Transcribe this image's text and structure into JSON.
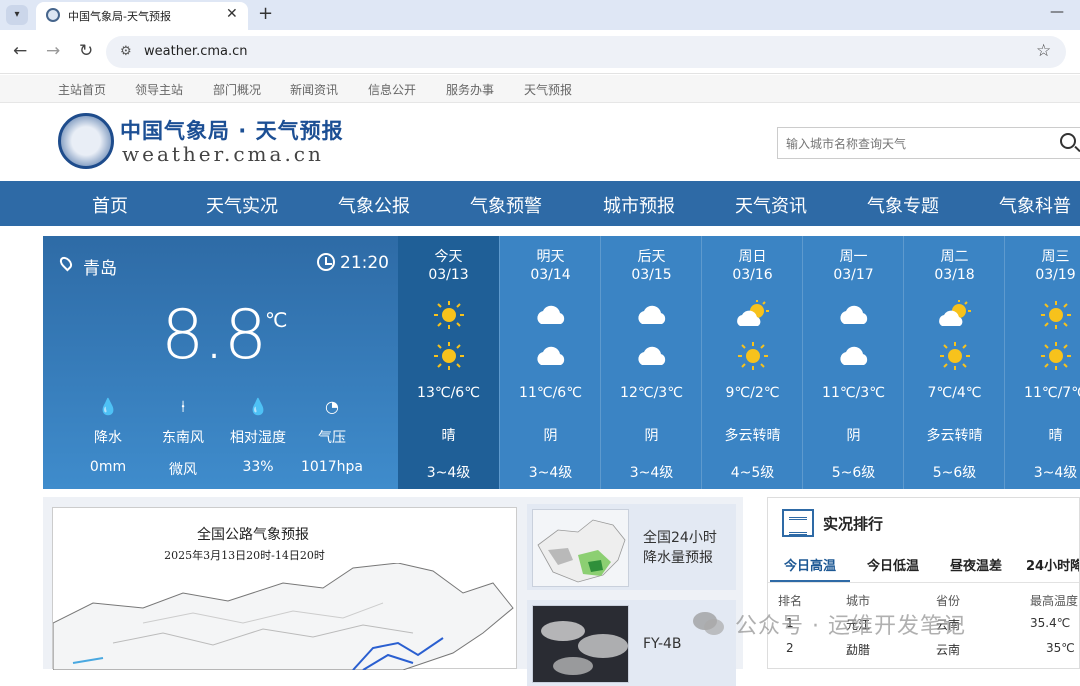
{
  "browser": {
    "tab_title": "中国气象局-天气预报",
    "url": "weather.cma.cn"
  },
  "topnav": [
    "主站首页",
    "领导主站",
    "部门概况",
    "新闻资讯",
    "信息公开",
    "服务办事",
    "天气预报"
  ],
  "logo": {
    "cn": "中国气象局 · 天气预报",
    "en": "weather.cma.cn"
  },
  "search": {
    "placeholder": "输入城市名称查询天气"
  },
  "mainnav": [
    "首页",
    "天气实况",
    "气象公报",
    "气象预警",
    "城市预报",
    "天气资讯",
    "气象专题",
    "气象科普"
  ],
  "current": {
    "city": "青岛",
    "time": "21:20",
    "temperature": "8.8",
    "unit": "℃",
    "metrics": [
      {
        "label": "降水",
        "value": "0mm",
        "icon": "raindrop-icon"
      },
      {
        "label": "东南风",
        "value": "微风",
        "icon": "wind-icon"
      },
      {
        "label": "相对湿度",
        "value": "33%",
        "icon": "humidity-icon"
      },
      {
        "label": "气压",
        "value": "1017hpa",
        "icon": "pressure-icon"
      }
    ]
  },
  "forecast": [
    {
      "day": "今天",
      "date": "03/13",
      "icon_day": "sunny",
      "icon_night": "sunny",
      "range": "13℃/6℃",
      "desc": "晴",
      "wind": "3~4级"
    },
    {
      "day": "明天",
      "date": "03/14",
      "icon_day": "cloudy",
      "icon_night": "cloudy",
      "range": "11℃/6℃",
      "desc": "阴",
      "wind": "3~4级"
    },
    {
      "day": "后天",
      "date": "03/15",
      "icon_day": "cloudy",
      "icon_night": "cloudy",
      "range": "12℃/3℃",
      "desc": "阴",
      "wind": "3~4级"
    },
    {
      "day": "周日",
      "date": "03/16",
      "icon_day": "partly-cloudy",
      "icon_night": "sunny",
      "range": "9℃/2℃",
      "desc": "多云转晴",
      "wind": "4~5级"
    },
    {
      "day": "周一",
      "date": "03/17",
      "icon_day": "cloudy",
      "icon_night": "cloudy",
      "range": "11℃/3℃",
      "desc": "阴",
      "wind": "5~6级"
    },
    {
      "day": "周二",
      "date": "03/18",
      "icon_day": "partly-cloudy",
      "icon_night": "sunny",
      "range": "7℃/4℃",
      "desc": "多云转晴",
      "wind": "5~6级"
    },
    {
      "day": "周三",
      "date": "03/19",
      "icon_day": "sunny",
      "icon_night": "sunny",
      "range": "11℃/7℃",
      "desc": "晴",
      "wind": "3~4级"
    }
  ],
  "map": {
    "title": "全国公路气象预报",
    "subtitle": "2025年3月13日20时-14日20时"
  },
  "thumbs": [
    {
      "label_line1": "全国24小时",
      "label_line2": "降水量预报"
    },
    {
      "label_line1": "FY-4B",
      "label_line2": ""
    }
  ],
  "ranking": {
    "title": "实况排行",
    "tabs": [
      "今日高温",
      "今日低温",
      "昼夜温差",
      "24小时降"
    ],
    "headers": [
      "排名",
      "城市",
      "省份",
      "最高温度"
    ],
    "rows": [
      [
        "1",
        "元江",
        "云南",
        "35.4℃"
      ],
      [
        "2",
        "勐腊",
        "云南",
        "35℃"
      ]
    ]
  },
  "watermark": "公众号 · 运维开发笔记",
  "colors": {
    "nav_blue": "#2e6aa6",
    "today_blue": "#1f5f97",
    "forecast_blue": "#3b84c4",
    "sun_yellow": "#f7c21c"
  }
}
